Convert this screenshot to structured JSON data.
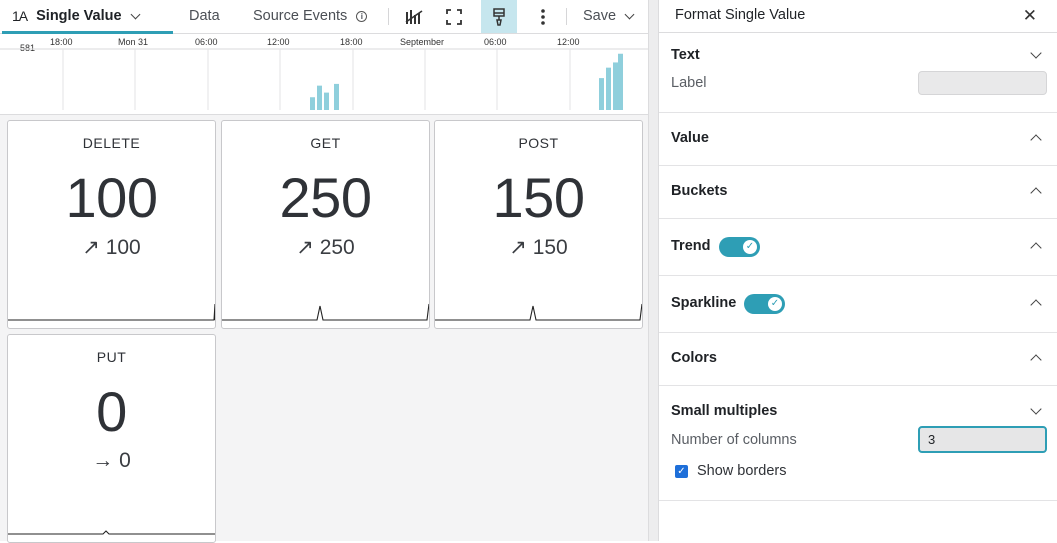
{
  "toolbar": {
    "viz_icon": "1A",
    "viz_label": "Single Value",
    "data_label": "Data",
    "events_label": "Source Events",
    "save_label": "Save",
    "icons": [
      "chart-split-icon",
      "fullscreen-icon",
      "paintbrush-icon",
      "more-vert-icon"
    ]
  },
  "timeline": {
    "max_label": "581",
    "ticks": [
      "18:00",
      "Mon 31",
      "06:00",
      "12:00",
      "18:00",
      "September",
      "06:00",
      "12:00"
    ],
    "bars": [
      {
        "group": 1,
        "heights": [
          0.22,
          0.42,
          0.3,
          0.0,
          0.45
        ]
      },
      {
        "group": 2,
        "heights": [
          0.55,
          0.73,
          0.82,
          0.97
        ]
      }
    ],
    "bar_color": "#8fcfdc"
  },
  "cards": [
    {
      "label": "DELETE",
      "value": "100",
      "trend_arrow": "↗",
      "trend_value": "100"
    },
    {
      "label": "GET",
      "value": "250",
      "trend_arrow": "↗",
      "trend_value": "250"
    },
    {
      "label": "POST",
      "value": "150",
      "trend_arrow": "↗",
      "trend_value": "150"
    },
    {
      "label": "PUT",
      "value": "0",
      "trend_arrow": "→",
      "trend_value": "0"
    }
  ],
  "panel": {
    "title": "Format Single Value",
    "sections": {
      "text": {
        "title": "Text",
        "label_field": "Label",
        "label_value": ""
      },
      "value": {
        "title": "Value"
      },
      "buckets": {
        "title": "Buckets"
      },
      "trend": {
        "title": "Trend",
        "enabled": true
      },
      "sparkline": {
        "title": "Sparkline",
        "enabled": true
      },
      "colors": {
        "title": "Colors"
      },
      "small_multiples": {
        "title": "Small multiples",
        "columns_label": "Number of columns",
        "columns_value": "3",
        "show_borders_label": "Show borders",
        "show_borders": true
      }
    }
  },
  "colors": {
    "accent": "#2e9eb5",
    "checkbox": "#1e6fd9"
  }
}
